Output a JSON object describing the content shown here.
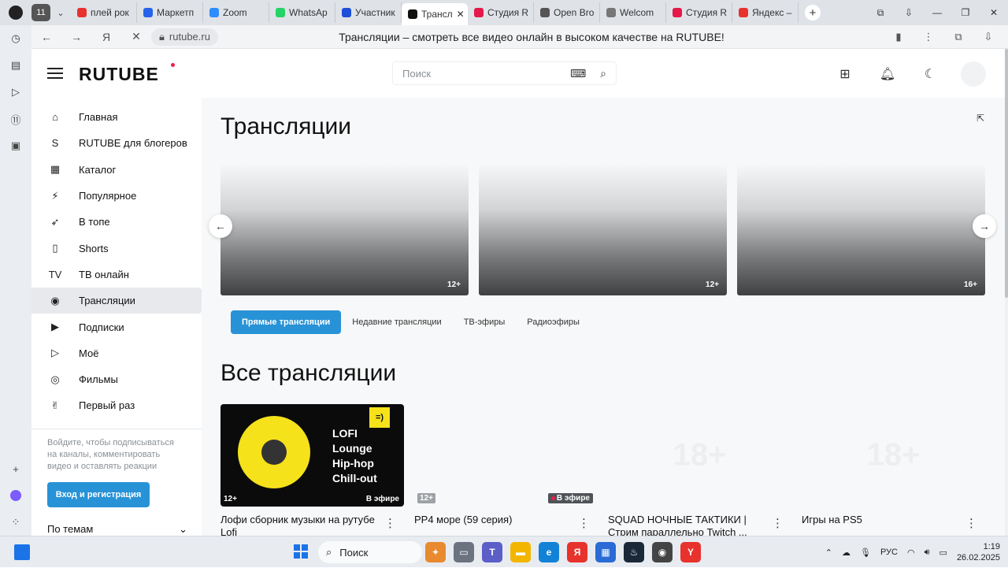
{
  "browser": {
    "tab_counter": "11",
    "tabs": [
      {
        "label": "плей рок",
        "color": "#e8322e"
      },
      {
        "label": "Маркетп",
        "color": "#2563eb"
      },
      {
        "label": "Zoom",
        "color": "#2d8cff"
      },
      {
        "label": "WhatsAp",
        "color": "#25d366"
      },
      {
        "label": "Участник",
        "color": "#1e4fd8"
      },
      {
        "label": "Трансл",
        "color": "#111111",
        "active": true
      },
      {
        "label": "Студия R",
        "color": "#e5184a"
      },
      {
        "label": "Open Bro",
        "color": "#555555"
      },
      {
        "label": "Welcom",
        "color": "#777777"
      },
      {
        "label": "Студия R",
        "color": "#e5184a"
      },
      {
        "label": "Яндекс –",
        "color": "#e8322e"
      }
    ],
    "url": "rutube.ru",
    "page_title": "Трансляции – смотреть все видео онлайн в высоком качестве на RUTUBE!"
  },
  "header": {
    "logo": "RUTUBE",
    "search_placeholder": "Поиск"
  },
  "sidebar": {
    "items": [
      {
        "label": "Главная",
        "icon": "⌂"
      },
      {
        "label": "RUTUBE для блогеров",
        "icon": "S"
      },
      {
        "label": "Каталог",
        "icon": "▦"
      },
      {
        "label": "Популярное",
        "icon": "⚡"
      },
      {
        "label": "В топе",
        "icon": "➶"
      },
      {
        "label": "Shorts",
        "icon": "▯"
      },
      {
        "label": "ТВ онлайн",
        "icon": "TV"
      },
      {
        "label": "Трансляции",
        "icon": "◉",
        "active": true
      },
      {
        "label": "Подписки",
        "icon": "▶"
      },
      {
        "label": "Моё",
        "icon": "▷"
      },
      {
        "label": "Фильмы",
        "icon": "◎"
      },
      {
        "label": "Первый раз",
        "icon": "✌"
      }
    ],
    "login_text": "Войдите, чтобы подписываться на каналы, комментировать видео и оставлять реакции",
    "login_button": "Вход и регистрация",
    "topics": "По темам"
  },
  "main": {
    "title": "Трансляции",
    "carousel": [
      {
        "age": "12+"
      },
      {
        "age": "12+"
      },
      {
        "age": "16+"
      }
    ],
    "filters": [
      {
        "label": "Прямые трансляции",
        "active": true
      },
      {
        "label": "Недавние трансляции"
      },
      {
        "label": "ТВ-эфиры"
      },
      {
        "label": "Радиоэфиры"
      }
    ],
    "all_title": "Все трансляции",
    "cards": [
      {
        "title": "Лофи сборник музыки на рутубе Lofi",
        "age": "12+",
        "live": "В эфире",
        "thumb_text": "LOFI Lounge Hip-hop Chill-out",
        "thumb_badge": "=)"
      },
      {
        "title": "PP4 море (59 серия)",
        "age": "12+",
        "live": "В эфире"
      },
      {
        "title": "SQUAD НОЧНЫЕ ТАКТИКИ | Стрим параллельно Twitch ...",
        "age_overlay": "18+"
      },
      {
        "title": "Игры на PS5",
        "age_overlay": "18+"
      }
    ]
  },
  "taskbar": {
    "search": "Поиск",
    "lang": "РУС",
    "time": "1:19",
    "date": "26.02.2025"
  }
}
